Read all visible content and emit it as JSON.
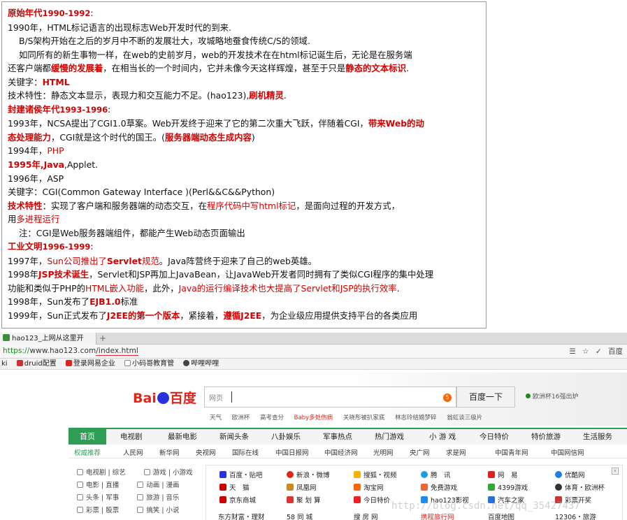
{
  "doc": {
    "era1": {
      "title": "原始年代",
      "years": "1990-1992",
      "colon": ":",
      "line1": "1990年，HTML标记语言的出现标志Web开发时代的到来.",
      "line2": "B/S架构开始在之后的岁月中不断的发展壮大，攻城略地蚕食传统C/S的领域.",
      "line3": "如同所有的新生事物一样，在web的史前岁月，web的开发技术在在html标记诞生后，无论是在服务端",
      "line4a": "还客户端都",
      "line4b": "缓慢的发展着",
      "line4c": "，在相当长的一个时间内，它并未像今天这样辉煌，甚至于只是",
      "line4d": "静态的文本标识",
      "line4e": ".",
      "kw_label": "关键字：",
      "kw_value": "HTML",
      "feat_label": "技术特性：静态文本显示，表现力和交互能力不足。(hao123),",
      "feat_value": "刷机精灵",
      "feat_end": "."
    },
    "era2": {
      "title": "封建诸侯年代",
      "years": "1993-1996",
      "colon": ":",
      "line1a": "1993年，NCSA提出了CGI1.0草案。Web开发终于迎来了它的第二次重大飞跃，伴随着CGI，",
      "line1b": "带来Web的动",
      "line2a": "态处理能力",
      "line2b": "，CGI就是这个时代的国王。(",
      "line2c": "服务器端动态生成内容",
      "line2d": ")",
      "y1994a": "1994年，",
      "y1994b": "PHP",
      "y1995a": "1995年,",
      "y1995b": "Java",
      "y1995c": ",Applet.",
      "y1996": "1996年，ASP",
      "kw": "关键字：CGI(Common Gateway Interface )(Perl&&C&&Python)",
      "feat_label": "技术特性",
      "feat_a": "：实现了客户端和服务器端的动态交互，在",
      "feat_b": "程序代码中写html标记",
      "feat_c": "，是面向过程的开发方式，",
      "feat2a": "用",
      "feat2b": "多进程运行",
      "note": "注：CGI是Web服务器端组件，都能产生Web动态页面输出"
    },
    "era3": {
      "title": "工业文明",
      "years": "1996-1999",
      "colon": ":",
      "y1997a": "1997年，",
      "y1997b": "Sun公司推出了",
      "y1997c": "Servlet",
      "y1997d": "规范",
      "y1997e": "。Java阵营终于迎来了自己的web英雄。",
      "y1998a": "1998年",
      "y1998b": "JSP技术诞生",
      "y1998c": "，Servlet和JSP再加上JavaBean，让JavaWeb开发者同时拥有了类似CGI程序的集中处理",
      "y1998d": "功能和类似于PHP的",
      "y1998e": "HTML嵌入功能",
      "y1998f": "，此外，",
      "y1998g": "Java的运行编译技术也大提高了Servlet和JSP的执行效率",
      "y1998h": ".",
      "ejb_a": "1998年，Sun发布了",
      "ejb_b": "EJB1.0",
      "ejb_c": "标准",
      "y1999a": "1999年，Sun正式发布了",
      "y1999b": "J2EE的第一个版本",
      "y1999c": "，紧接着，",
      "y1999d": "遵循J2EE",
      "y1999e": "，为企业级应用提供支持平台的各类应用"
    }
  },
  "browser": {
    "tab_title": "hao123_上网从这里开",
    "new_tab": "+",
    "url_scheme": "https://",
    "url_host": "www.hao123.com",
    "url_path": "/index.html",
    "addr_icons": [
      "☰",
      "☆",
      "✓",
      "百度"
    ],
    "bookmarks": [
      "ki",
      "druid配置",
      "登录网易企业",
      "小码哥教育管",
      "哔哩哔哩"
    ],
    "logo_bai": "Bai",
    "logo_du": "百度",
    "search_select": "网页",
    "search_badge": "5",
    "search_button": "百度一下",
    "worldcup": "欧洲杯16强出炉",
    "hotlinks": [
      "天气",
      "欧洲杯",
      "高考查分",
      "Baby多处伤病",
      "关晓彤被扒家底",
      "林志玲结婚梦碎",
      "翁虹谈三级片"
    ],
    "nav": [
      "首页",
      "电视剧",
      "最新电影",
      "新闻头条",
      "八卦娱乐",
      "军事热点",
      "热门游戏",
      "小 游 戏",
      "今日特价",
      "特价旅游",
      "生活服务"
    ],
    "subnav": [
      "权威推荐",
      "人民网",
      "新华网",
      "央视网",
      "国际在线",
      "中国日报网",
      "中国经济网",
      "光明网",
      "央广网",
      "求是网",
      "中国青年网",
      "中国网信网"
    ],
    "left_col": [
      [
        "电视剧",
        "综艺",
        "游戏",
        "小游戏"
      ],
      [
        "电影",
        "直播",
        "动画",
        "漫画"
      ],
      [
        "头条",
        "军事",
        "旅游",
        "音乐"
      ],
      [
        "彩票",
        "股票",
        "搞笑",
        "小说"
      ]
    ],
    "sites": [
      [
        "百度・贴吧",
        "新浪・微博",
        "搜狐・视频",
        "腾　讯",
        "网　易",
        "优酷网"
      ],
      [
        "天　猫",
        "凤凰网",
        "淘宝网",
        "免费游戏",
        "4399游戏",
        "体育・欧洲杯"
      ],
      [
        "京东商城",
        "聚 划 算",
        "今日特价",
        "hao123影视",
        "汽车之家",
        "彩票开奖"
      ]
    ],
    "bottom_row": [
      "东方财富・理财",
      "58 同 城",
      "搜 房 网",
      "携程旅行网",
      "百度地图",
      "12306・旅游"
    ],
    "watermark": "http://blog.csdn.net/qq_35427437"
  },
  "colors": {
    "red": "#d40000",
    "green": "#2f9e55",
    "baidu_red": "#e1251b",
    "baidu_blue": "#2932e1"
  }
}
